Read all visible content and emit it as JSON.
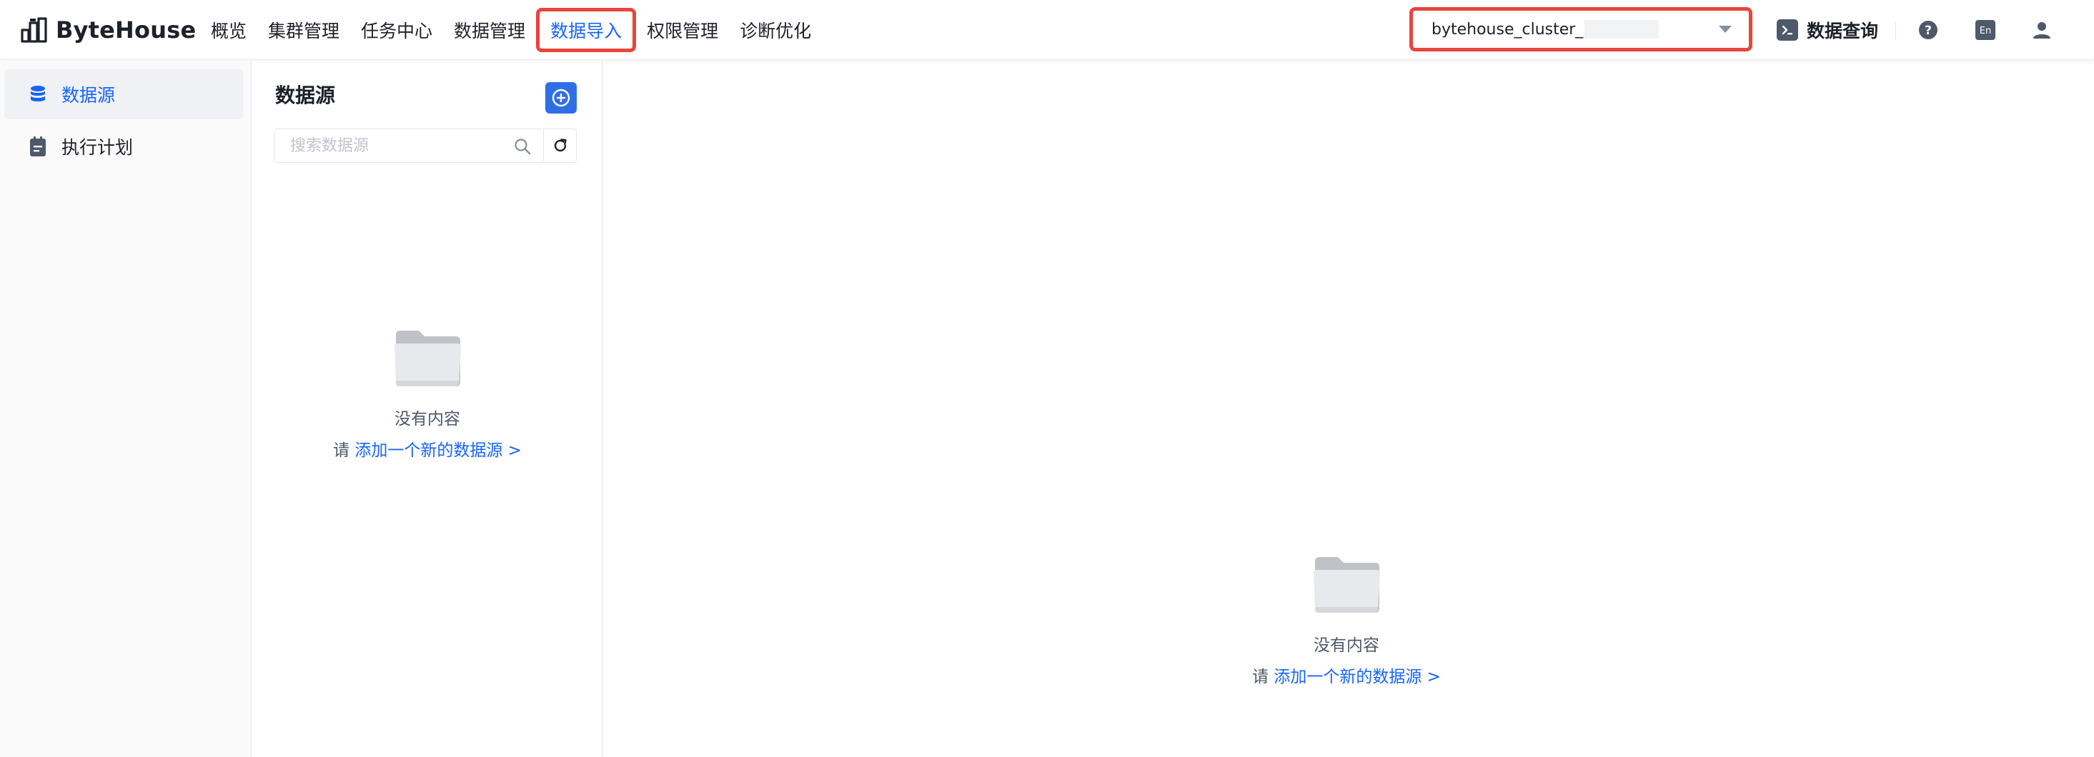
{
  "app": {
    "name": "ByteHouse"
  },
  "nav": {
    "items": [
      {
        "label": "概览"
      },
      {
        "label": "集群管理"
      },
      {
        "label": "任务中心"
      },
      {
        "label": "数据管理"
      },
      {
        "label": "数据导入"
      },
      {
        "label": "权限管理"
      },
      {
        "label": "诊断优化"
      }
    ],
    "active_index": 4
  },
  "cluster_select": {
    "value": "bytehouse_cluster_"
  },
  "header_actions": {
    "query_label": "数据查询",
    "help_icon": "help-circle-icon",
    "language_label": "En",
    "user_icon": "user-icon"
  },
  "sidebar": {
    "items": [
      {
        "label": "数据源",
        "icon": "database-icon",
        "active": true
      },
      {
        "label": "执行计划",
        "icon": "clipboard-icon",
        "active": false
      }
    ]
  },
  "panel": {
    "title": "数据源",
    "search_placeholder": "搜索数据源",
    "empty_title": "没有内容",
    "empty_prefix": "请",
    "empty_link": "添加一个新的数据源 >"
  },
  "main": {
    "empty_title": "没有内容",
    "empty_prefix": "请",
    "empty_link": "添加一个新的数据源 >"
  },
  "colors": {
    "accent": "#1664ff",
    "highlight_border": "#e8453c",
    "add_button": "#2f6fe6"
  }
}
